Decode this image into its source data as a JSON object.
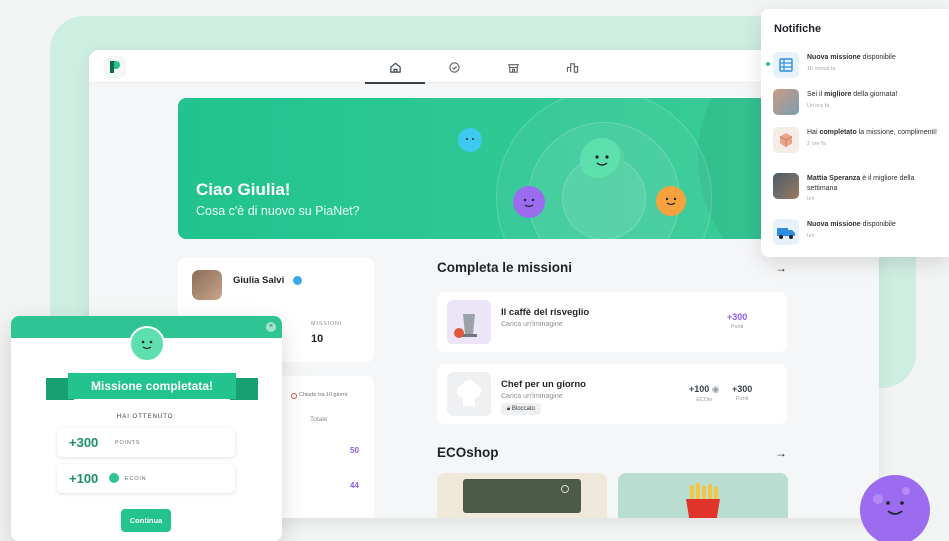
{
  "app": {
    "nav": [
      {
        "icon": "home-icon",
        "active": true
      },
      {
        "icon": "check-circle-icon",
        "active": false
      },
      {
        "icon": "shop-icon",
        "active": false
      },
      {
        "icon": "leaderboard-icon",
        "active": false
      }
    ]
  },
  "hero": {
    "title": "Ciao Giulia!",
    "subtitle": "Cosa c'è di nuovo su PiaNet?"
  },
  "profile": {
    "name": "Giulia Salvi",
    "missions_label": "MISSIONI",
    "missions_value": "10"
  },
  "leaderboard": {
    "closes": "Chiude tra 10 giorni",
    "col": "Totale",
    "values": [
      "50",
      "44"
    ]
  },
  "missions": {
    "title": "Completa le missioni",
    "items": [
      {
        "title": "Il caffè del risveglio",
        "subtitle": "Carica un'immagine",
        "points": "+300",
        "points_label": "Punti"
      },
      {
        "title": "Chef per un giorno",
        "subtitle": "Carica un'immagine",
        "badge": "Bloccato",
        "ecoin": "+100",
        "ecoin_label": "ECOin",
        "points": "+300",
        "points_label": "Punti"
      }
    ]
  },
  "ecoshop": {
    "title": "ECOshop"
  },
  "notifications": {
    "title": "Notifiche",
    "items": [
      {
        "pre": "",
        "bold": "Nuova missione",
        "post": " disponibile",
        "time": "10 minuti fa"
      },
      {
        "pre": "Sei il ",
        "bold": "migliore",
        "post": " della giornata!",
        "time": "Un'ora fa"
      },
      {
        "pre": "Hai ",
        "bold": "completato",
        "post": " la missione, complimenti!",
        "time": "2 ore fa"
      },
      {
        "pre": "",
        "bold": "Mattia Speranza",
        "post": " è il migliore della settimana",
        "time": "Ieri"
      },
      {
        "pre": "",
        "bold": "Nuova missione",
        "post": " disponibile",
        "time": "Ieri"
      }
    ]
  },
  "modal": {
    "title": "Missione completata!",
    "got_label": "HAI OTTENUTO:",
    "rewards": [
      {
        "value": "+300",
        "unit": "POINTS"
      },
      {
        "value": "+100",
        "unit": "ECOIN"
      }
    ],
    "cta": "Continua",
    "close": "×"
  },
  "colors": {
    "accent": "#2fc493",
    "accent_dark": "#189f72",
    "mint_bg": "#cfeee2",
    "purple": "#8b5cf6"
  }
}
